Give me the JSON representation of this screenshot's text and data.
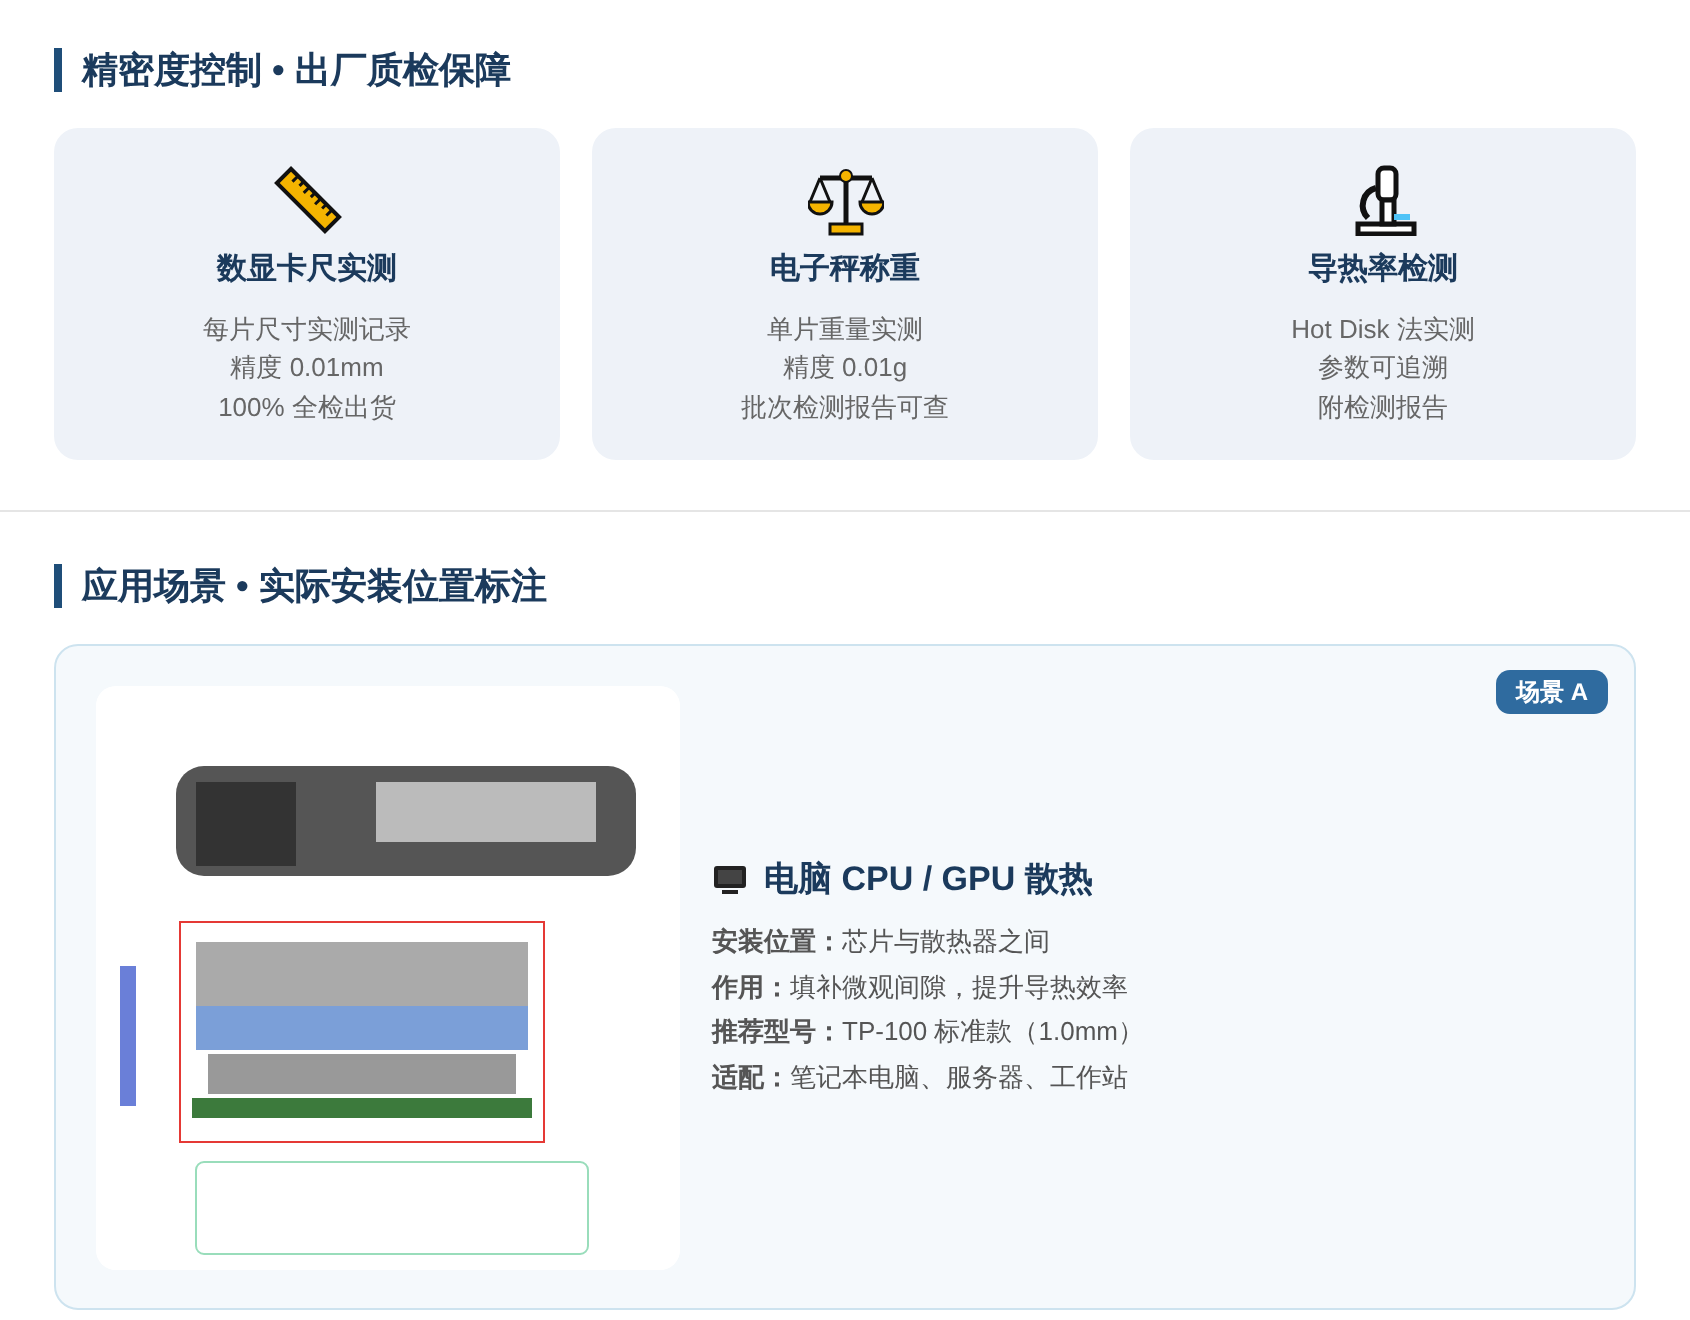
{
  "sections": [
    {
      "title": "精密度控制 • 出厂质检保障",
      "kind": "cards",
      "cards": [
        {
          "kind": "ruler",
          "title": "数显卡尺实测",
          "lines": [
            "每片尺寸实测记录",
            "精度 0.01mm",
            "100% 全检出货"
          ]
        },
        {
          "kind": "scale",
          "title": "电子秤称重",
          "lines": [
            "单片重量实测",
            "精度 0.01g",
            "批次检测报告可查"
          ]
        },
        {
          "kind": "microscope",
          "title": "导热率检测",
          "lines": [
            "Hot Disk 法实测",
            "参数可追溯",
            "附检测报告"
          ]
        }
      ]
    },
    {
      "title": "应用场景 • 实际安装位置标注",
      "kind": "scenario",
      "scenario": {
        "badge": "场景 A",
        "heading": "电脑 CPU / GPU 散热",
        "specs": [
          "**安装位置：**芯片与散热器之间",
          "**作用：**填补微观间隙，提升导热效率",
          "**推荐型号：**TP-100 标准款（1.0mm）",
          "**适配：**笔记本电脑、服务器、工作站"
        ]
      }
    }
  ]
}
